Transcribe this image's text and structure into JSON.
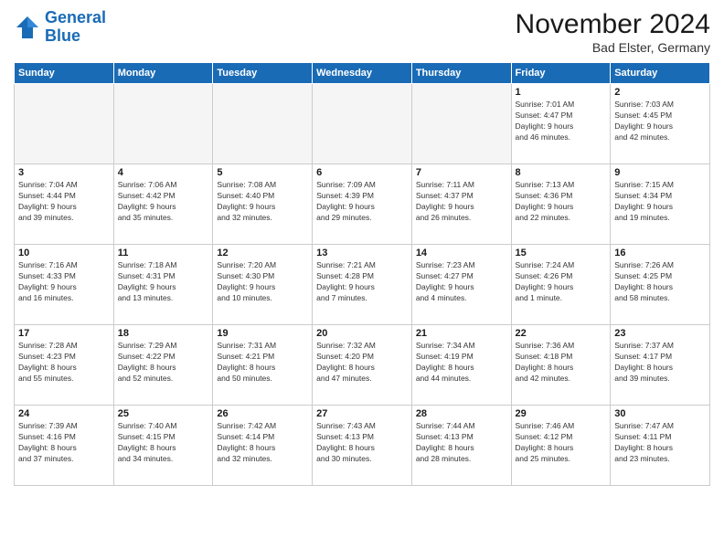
{
  "header": {
    "logo_line1": "General",
    "logo_line2": "Blue",
    "month_title": "November 2024",
    "location": "Bad Elster, Germany"
  },
  "days_of_week": [
    "Sunday",
    "Monday",
    "Tuesday",
    "Wednesday",
    "Thursday",
    "Friday",
    "Saturday"
  ],
  "weeks": [
    [
      {
        "day": "",
        "info": ""
      },
      {
        "day": "",
        "info": ""
      },
      {
        "day": "",
        "info": ""
      },
      {
        "day": "",
        "info": ""
      },
      {
        "day": "",
        "info": ""
      },
      {
        "day": "1",
        "info": "Sunrise: 7:01 AM\nSunset: 4:47 PM\nDaylight: 9 hours\nand 46 minutes."
      },
      {
        "day": "2",
        "info": "Sunrise: 7:03 AM\nSunset: 4:45 PM\nDaylight: 9 hours\nand 42 minutes."
      }
    ],
    [
      {
        "day": "3",
        "info": "Sunrise: 7:04 AM\nSunset: 4:44 PM\nDaylight: 9 hours\nand 39 minutes."
      },
      {
        "day": "4",
        "info": "Sunrise: 7:06 AM\nSunset: 4:42 PM\nDaylight: 9 hours\nand 35 minutes."
      },
      {
        "day": "5",
        "info": "Sunrise: 7:08 AM\nSunset: 4:40 PM\nDaylight: 9 hours\nand 32 minutes."
      },
      {
        "day": "6",
        "info": "Sunrise: 7:09 AM\nSunset: 4:39 PM\nDaylight: 9 hours\nand 29 minutes."
      },
      {
        "day": "7",
        "info": "Sunrise: 7:11 AM\nSunset: 4:37 PM\nDaylight: 9 hours\nand 26 minutes."
      },
      {
        "day": "8",
        "info": "Sunrise: 7:13 AM\nSunset: 4:36 PM\nDaylight: 9 hours\nand 22 minutes."
      },
      {
        "day": "9",
        "info": "Sunrise: 7:15 AM\nSunset: 4:34 PM\nDaylight: 9 hours\nand 19 minutes."
      }
    ],
    [
      {
        "day": "10",
        "info": "Sunrise: 7:16 AM\nSunset: 4:33 PM\nDaylight: 9 hours\nand 16 minutes."
      },
      {
        "day": "11",
        "info": "Sunrise: 7:18 AM\nSunset: 4:31 PM\nDaylight: 9 hours\nand 13 minutes."
      },
      {
        "day": "12",
        "info": "Sunrise: 7:20 AM\nSunset: 4:30 PM\nDaylight: 9 hours\nand 10 minutes."
      },
      {
        "day": "13",
        "info": "Sunrise: 7:21 AM\nSunset: 4:28 PM\nDaylight: 9 hours\nand 7 minutes."
      },
      {
        "day": "14",
        "info": "Sunrise: 7:23 AM\nSunset: 4:27 PM\nDaylight: 9 hours\nand 4 minutes."
      },
      {
        "day": "15",
        "info": "Sunrise: 7:24 AM\nSunset: 4:26 PM\nDaylight: 9 hours\nand 1 minute."
      },
      {
        "day": "16",
        "info": "Sunrise: 7:26 AM\nSunset: 4:25 PM\nDaylight: 8 hours\nand 58 minutes."
      }
    ],
    [
      {
        "day": "17",
        "info": "Sunrise: 7:28 AM\nSunset: 4:23 PM\nDaylight: 8 hours\nand 55 minutes."
      },
      {
        "day": "18",
        "info": "Sunrise: 7:29 AM\nSunset: 4:22 PM\nDaylight: 8 hours\nand 52 minutes."
      },
      {
        "day": "19",
        "info": "Sunrise: 7:31 AM\nSunset: 4:21 PM\nDaylight: 8 hours\nand 50 minutes."
      },
      {
        "day": "20",
        "info": "Sunrise: 7:32 AM\nSunset: 4:20 PM\nDaylight: 8 hours\nand 47 minutes."
      },
      {
        "day": "21",
        "info": "Sunrise: 7:34 AM\nSunset: 4:19 PM\nDaylight: 8 hours\nand 44 minutes."
      },
      {
        "day": "22",
        "info": "Sunrise: 7:36 AM\nSunset: 4:18 PM\nDaylight: 8 hours\nand 42 minutes."
      },
      {
        "day": "23",
        "info": "Sunrise: 7:37 AM\nSunset: 4:17 PM\nDaylight: 8 hours\nand 39 minutes."
      }
    ],
    [
      {
        "day": "24",
        "info": "Sunrise: 7:39 AM\nSunset: 4:16 PM\nDaylight: 8 hours\nand 37 minutes."
      },
      {
        "day": "25",
        "info": "Sunrise: 7:40 AM\nSunset: 4:15 PM\nDaylight: 8 hours\nand 34 minutes."
      },
      {
        "day": "26",
        "info": "Sunrise: 7:42 AM\nSunset: 4:14 PM\nDaylight: 8 hours\nand 32 minutes."
      },
      {
        "day": "27",
        "info": "Sunrise: 7:43 AM\nSunset: 4:13 PM\nDaylight: 8 hours\nand 30 minutes."
      },
      {
        "day": "28",
        "info": "Sunrise: 7:44 AM\nSunset: 4:13 PM\nDaylight: 8 hours\nand 28 minutes."
      },
      {
        "day": "29",
        "info": "Sunrise: 7:46 AM\nSunset: 4:12 PM\nDaylight: 8 hours\nand 25 minutes."
      },
      {
        "day": "30",
        "info": "Sunrise: 7:47 AM\nSunset: 4:11 PM\nDaylight: 8 hours\nand 23 minutes."
      }
    ]
  ]
}
